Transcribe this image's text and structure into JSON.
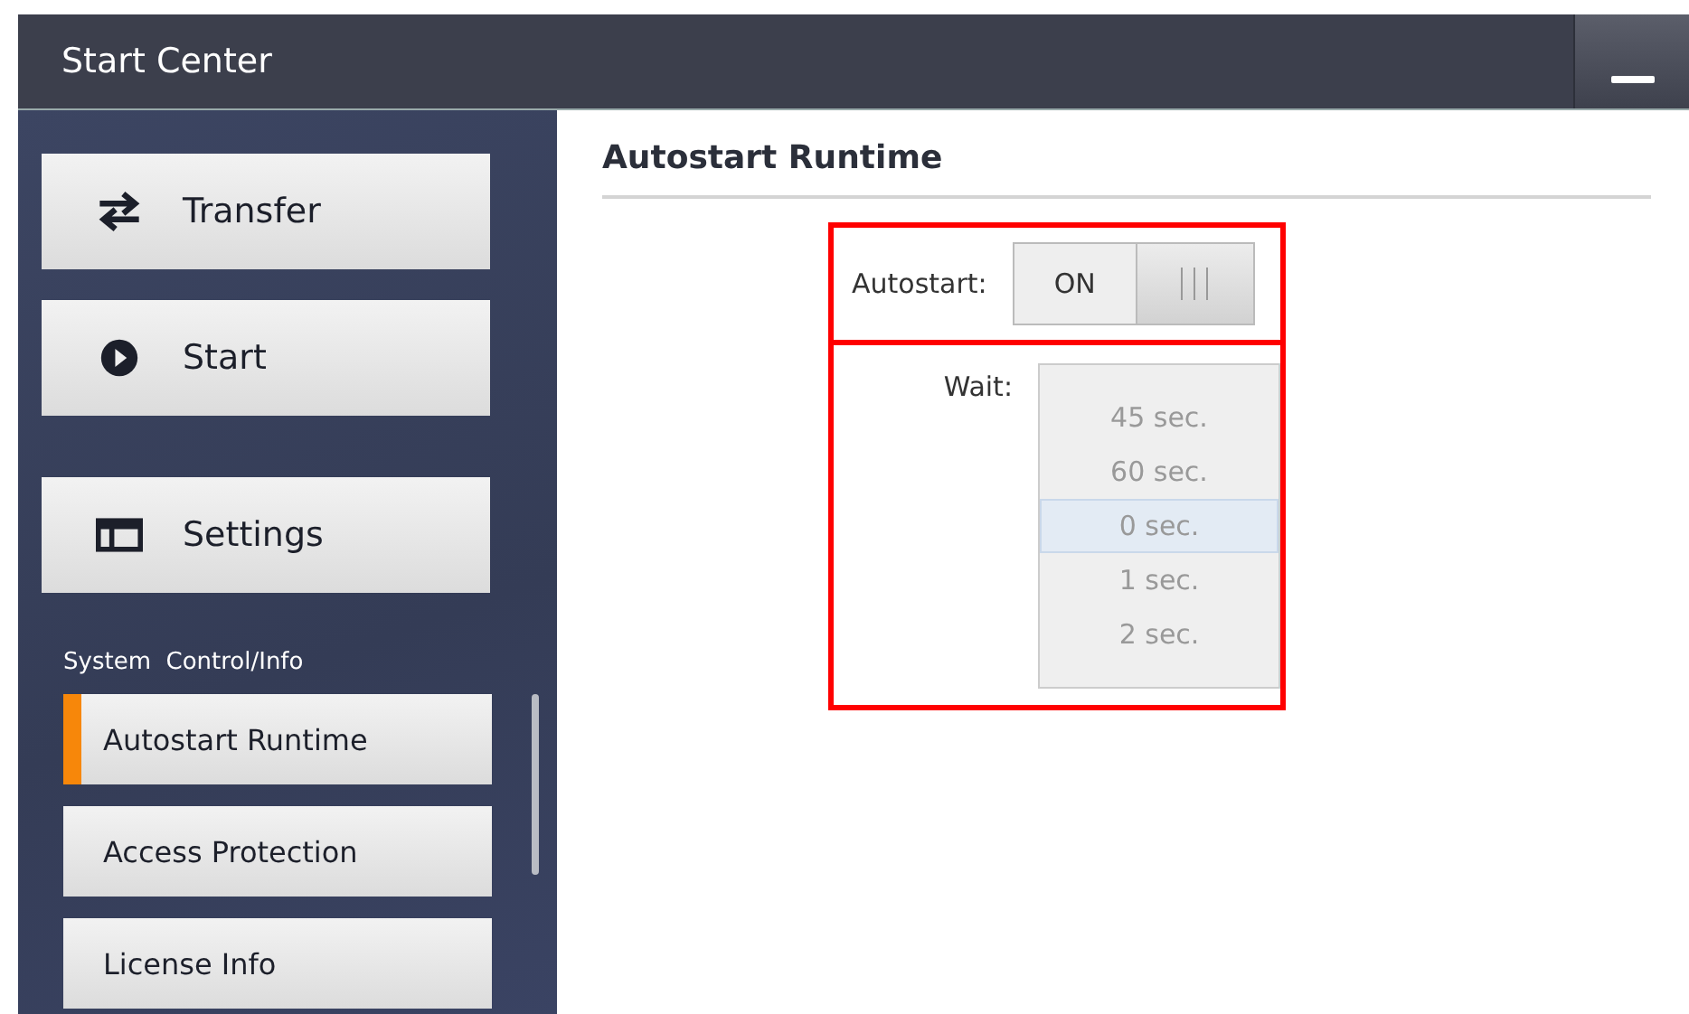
{
  "window": {
    "title": "Start Center"
  },
  "sidebar": {
    "actions": [
      {
        "label": "Transfer",
        "kind": "transfer"
      },
      {
        "label": "Start",
        "kind": "start"
      },
      {
        "label": "Settings",
        "kind": "settings"
      }
    ],
    "section_label": "System  Control/Info",
    "items": [
      {
        "label": "Autostart Runtime",
        "selected": true
      },
      {
        "label": "Access Protection",
        "selected": false
      },
      {
        "label": "License Info",
        "selected": false
      }
    ]
  },
  "content": {
    "heading": "Autostart Runtime",
    "autostart": {
      "label": "Autostart:",
      "on": true,
      "on_text": "ON"
    },
    "wait": {
      "label": "Wait:",
      "options": [
        {
          "label": "45 sec.",
          "selected": false
        },
        {
          "label": "60 sec.",
          "selected": false
        },
        {
          "label": "0 sec.",
          "selected": true
        },
        {
          "label": "1 sec.",
          "selected": false
        },
        {
          "label": "2 sec.",
          "selected": false
        }
      ]
    }
  }
}
